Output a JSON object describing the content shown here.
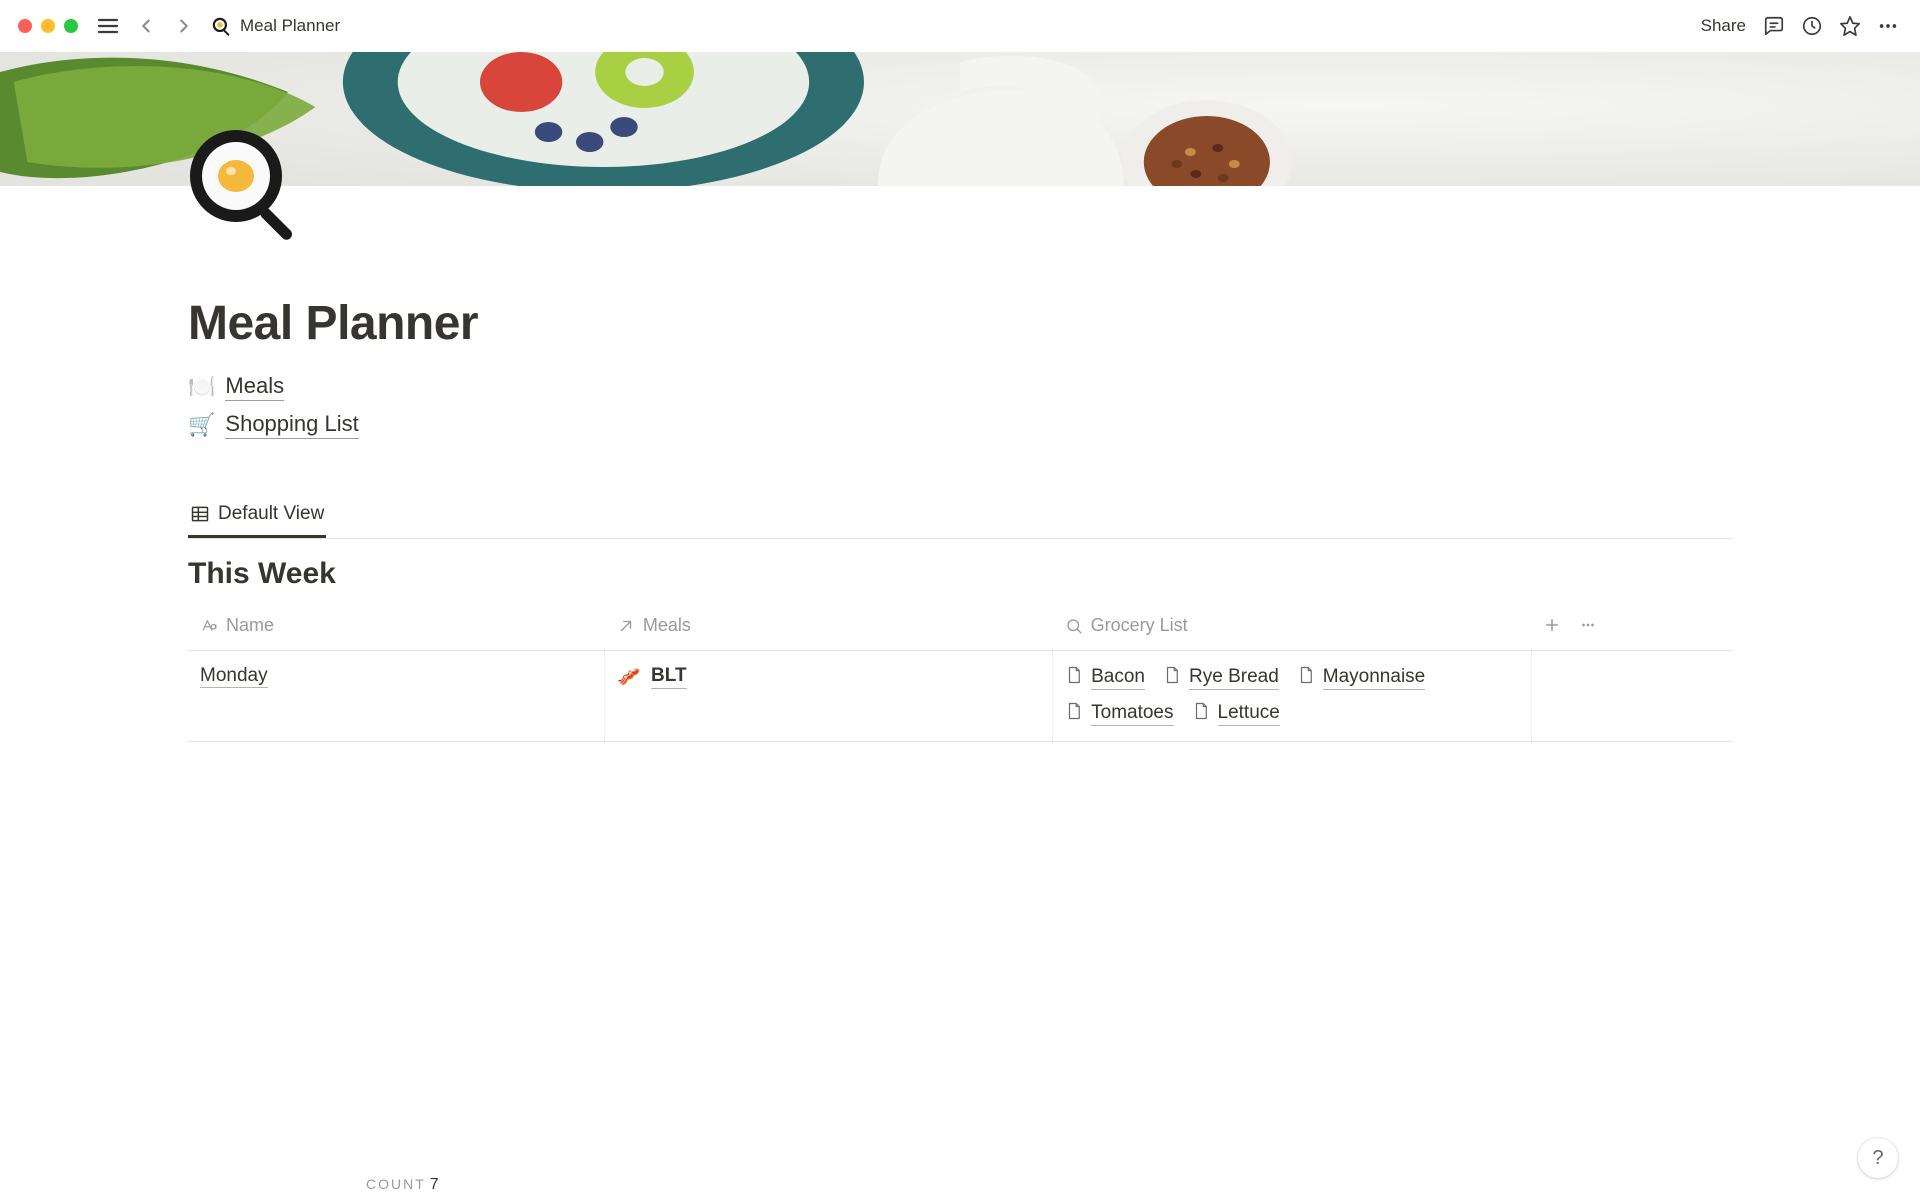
{
  "window": {
    "breadcrumb_title": "Meal Planner",
    "share_label": "Share"
  },
  "page": {
    "icon_emoji": "🍳",
    "title": "Meal Planner",
    "linked_pages": [
      {
        "emoji": "🍽️",
        "label": "Meals"
      },
      {
        "emoji": "🛒",
        "label": "Shopping List"
      }
    ]
  },
  "database": {
    "view_name": "Default View",
    "title": "This Week",
    "columns": [
      {
        "type": "title",
        "label": "Name"
      },
      {
        "type": "relation",
        "label": "Meals"
      },
      {
        "type": "rollup",
        "label": "Grocery List"
      }
    ],
    "rows": [
      {
        "name": "Monday",
        "meals": [
          {
            "emoji": "🥓",
            "label": "BLT"
          }
        ],
        "grocery": [
          "Bacon",
          "Rye Bread",
          "Mayonnaise",
          "Tomatoes",
          "Lettuce"
        ]
      }
    ],
    "count_label": "COUNT",
    "count_value": "7"
  },
  "help_label": "?"
}
